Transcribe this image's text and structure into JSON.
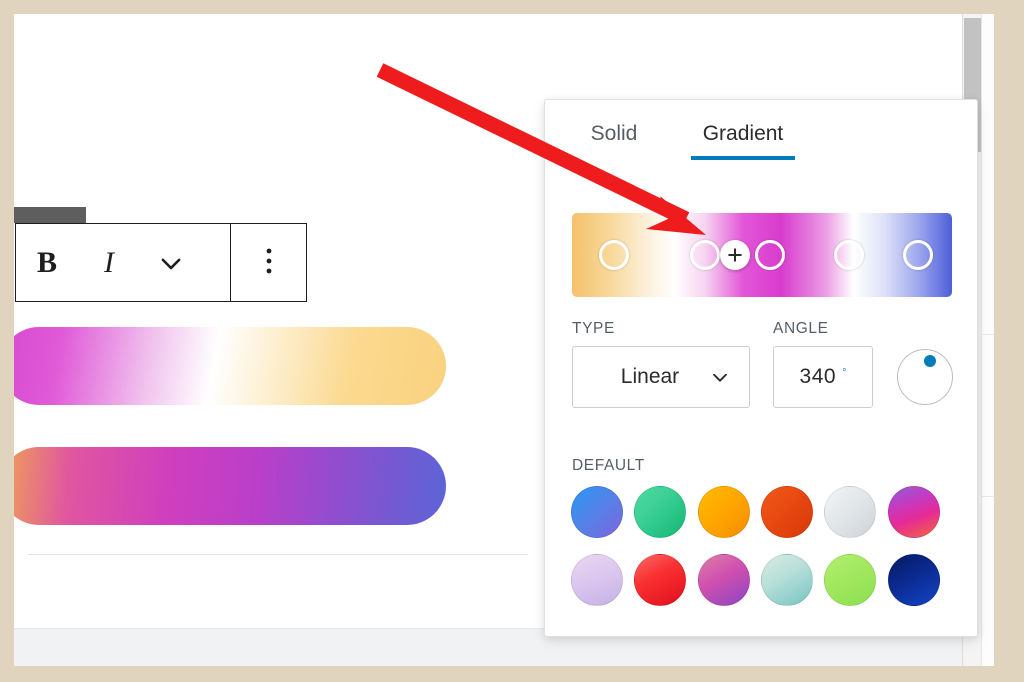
{
  "frame": {
    "background_color": "#e0d4bf"
  },
  "editor": {
    "block_toolbar": {
      "bold_label": "B",
      "italic_label": "I",
      "dropdown_icon": "chevron-down-icon",
      "more_options_icon": "three-dots-vertical-icon"
    },
    "sample_blocks": [
      {
        "name": "gradient-preview-bar-1",
        "gradient": "linear-gradient(100deg, #d649cf 0%, #e05bd8 14%, #f1c3ee 34%, #ffffff 48%, #fdf0d2 60%, #fbd98f 78%, #f9d27f 100%)"
      },
      {
        "name": "gradient-preview-bar-2",
        "gradient": "linear-gradient(95deg, #f0a355 0%, #e0569f 16%, #cf3fbe 38%, #b93fc9 58%, #8a50cf 78%, #5b64d6 100%)"
      }
    ]
  },
  "popover": {
    "tabs": [
      {
        "id": "solid",
        "label": "Solid",
        "active": false
      },
      {
        "id": "gradient",
        "label": "Gradient",
        "active": true
      }
    ],
    "active_tab_accent": "#007cba",
    "gradient_bar": {
      "css": "linear-gradient(90deg, #f5c16c 0%, #f8d694 9%, #fcf0dc 20%, #ffffff 27%, #f6d4f0 35%, #e356d8 45%, #d83ccd 55%, #ec9fe5 67%, #ffffff 74%, #dfe2f7 82%, #9fa8ee 91%, #4c5fd7 100%)",
      "stops": [
        {
          "name": "color-stop-handle-1",
          "position_pct": 11,
          "color": "#f5c16c"
        },
        {
          "name": "color-stop-handle-2",
          "position_pct": 35,
          "color": "#f0c9ea"
        },
        {
          "name": "color-stop-handle-3",
          "position_pct": 52,
          "color": "#d83ccd"
        },
        {
          "name": "color-stop-handle-4",
          "position_pct": 73,
          "color": "#ffffff"
        },
        {
          "name": "color-stop-handle-5",
          "position_pct": 91,
          "color": "#4c5fd7"
        }
      ],
      "insert_point": {
        "name": "insert-color-stop-button",
        "position_pct": 43,
        "icon": "plus-icon"
      }
    },
    "type": {
      "label": "Type",
      "value": "Linear",
      "chevron_icon": "chevron-down-icon"
    },
    "angle": {
      "label": "Angle",
      "value": "340",
      "unit": "°",
      "dial_icon": "angle-dial"
    },
    "defaults": {
      "label": "Default",
      "swatches": [
        {
          "name": "gradient-swatch-vivid-cyan-blue-to-vivid-purple",
          "css": "linear-gradient(135deg, #2e8ced 0%, #3a8ff0 18%, #5a7fe6 55%, #7e63dd 100%)"
        },
        {
          "name": "gradient-swatch-light-green-cyan-to-vivid-green-cyan",
          "css": "linear-gradient(135deg, #4ddba0 0%, #3fd197 35%, #14b877 100%)"
        },
        {
          "name": "gradient-swatch-luminous-vivid-amber-to-luminous-vivid-orange",
          "css": "linear-gradient(135deg, #ffbb00 0%, #ffa800 45%, #f78c00 100%)"
        },
        {
          "name": "gradient-swatch-luminous-vivid-orange-to-vivid-red",
          "css": "linear-gradient(135deg, #f05a1a 0%, #e8490f 45%, #d8380c 100%)"
        },
        {
          "name": "gradient-swatch-very-light-gray-to-cyan-bluish-gray",
          "css": "linear-gradient(135deg, #f3f5f7 0%, #e3e7ea 45%, #ccd3d9 100%)"
        },
        {
          "name": "gradient-swatch-cool-to-warm-spectrum",
          "css": "linear-gradient(160deg, #8e5fd6 0%, #c13cc4 30%, #e62a97 60%, #f2683a 100%)"
        },
        {
          "name": "gradient-swatch-blush-light-purple",
          "css": "linear-gradient(160deg, #e9d6f2 0%, #dcc7ee 45%, #c3b2e6 100%)"
        },
        {
          "name": "gradient-swatch-blush-bordeaux",
          "css": "linear-gradient(150deg, #fb6a6a 0%, #f93131 40%, #e00e1e 100%)"
        },
        {
          "name": "gradient-swatch-luminous-dusk",
          "css": "linear-gradient(150deg, #de7fa5 0%, #cf4fb0 45%, #8c46c4 100%)"
        },
        {
          "name": "gradient-swatch-pale-ocean",
          "css": "linear-gradient(150deg, #d8ece0 0%, #b6ded9 45%, #74c4c1 100%)"
        },
        {
          "name": "gradient-swatch-electric-grass",
          "css": "linear-gradient(150deg, #b3ee6f 0%, #a2e85f 45%, #8cdf52 100%)"
        },
        {
          "name": "gradient-swatch-midnight",
          "css": "linear-gradient(150deg, #061a5e 0%, #0b2a91 45%, #1345c2 100%)"
        }
      ]
    }
  },
  "scrollbar": {
    "name": "vertical-scrollbar",
    "thumb_color": "#c2c2c2"
  },
  "annotation": {
    "name": "red-arrow-annotation",
    "color": "#ee1c1c"
  }
}
